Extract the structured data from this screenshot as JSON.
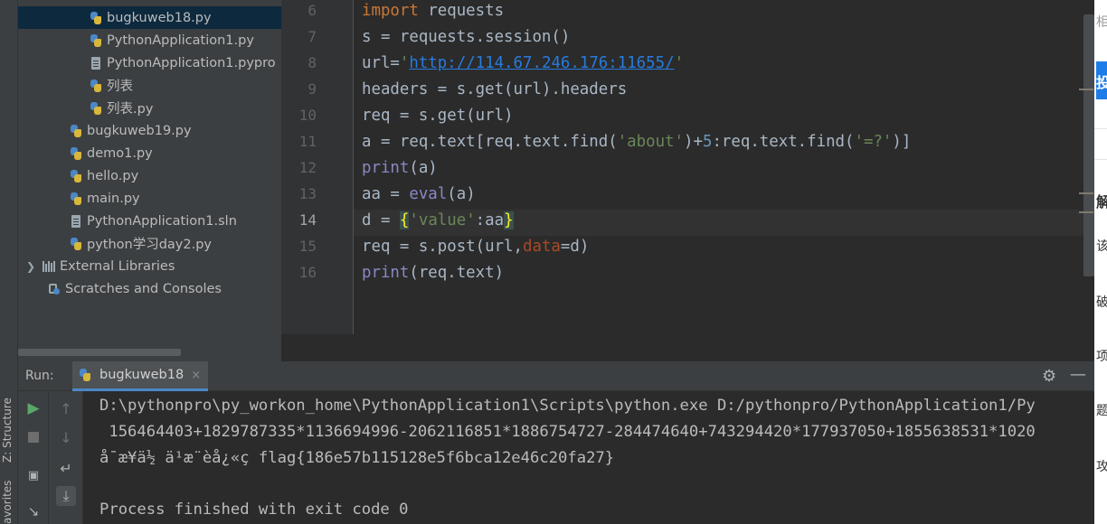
{
  "side_strip": {
    "structure_label": "Z: Structure",
    "favorites_label": "avorites"
  },
  "project_tree": [
    {
      "name": "bugkuweb18.py",
      "type": "python",
      "selected": true
    },
    {
      "name": "PythonApplication1.py",
      "type": "python",
      "selected": false
    },
    {
      "name": "PythonApplication1.pypro",
      "type": "file",
      "selected": false
    },
    {
      "name": "列表",
      "type": "python",
      "selected": false
    },
    {
      "name": "列表.py",
      "type": "python",
      "selected": false
    },
    {
      "name": "bugkuweb19.py",
      "type": "python",
      "selected": false
    },
    {
      "name": "demo1.py",
      "type": "python",
      "selected": false
    },
    {
      "name": "hello.py",
      "type": "python",
      "selected": false
    },
    {
      "name": "main.py",
      "type": "python",
      "selected": false
    },
    {
      "name": "PythonApplication1.sln",
      "type": "file",
      "selected": false
    },
    {
      "name": "python学习day2.py",
      "type": "python",
      "selected": false
    },
    {
      "name": "External Libraries",
      "type": "library",
      "selected": false
    },
    {
      "name": "Scratches and Consoles",
      "type": "scratch",
      "selected": false
    }
  ],
  "editor": {
    "line_numbers": [
      "6",
      "7",
      "8",
      "9",
      "10",
      "11",
      "12",
      "13",
      "14",
      "15",
      "16"
    ],
    "current_line": "14",
    "code": {
      "l6": {
        "kw": "import",
        "rest": " requests"
      },
      "l7": {
        "text": "s = requests.session()"
      },
      "l8": {
        "a": "url",
        "b": "=",
        "c": "'",
        "url": "http://114.67.246.176:11655/",
        "d": "'"
      },
      "l9": {
        "text": "headers = s.get(url).headers"
      },
      "l10": {
        "text": "req = s.get(url)"
      },
      "l11": {
        "a": "a = req.text[req.text.find(",
        "s1": "'about'",
        "b": ")+",
        "n": "5",
        "c": ":req.text.find(",
        "s2": "'=?'",
        "d": ")]"
      },
      "l12": {
        "fn": "print",
        "rest": "(a)"
      },
      "l13": {
        "a": "aa = ",
        "fn": "eval",
        "rest": "(a)"
      },
      "l14": {
        "a": "d = ",
        "open": "{",
        "s": "'value'",
        "b": ":aa",
        "close": "}"
      },
      "l15": {
        "a": "req = s.post(url,",
        "p": "data",
        "b": "=d)"
      },
      "l16": {
        "fn": "print",
        "rest": "(req.text)"
      }
    }
  },
  "run": {
    "label": "Run:",
    "tab": "bugkuweb18",
    "tab_close": "×",
    "gear_icon": "⚙",
    "minimize_icon": "—",
    "console": [
      "D:\\pythonpro\\py_workon_home\\PythonApplication1\\Scripts\\python.exe D:/pythonpro/PythonApplication1/Py",
      " 156464403+1829787335*1136694996-2062116851*1886754727-284474640+743294420*177937050+1855638531*1020",
      "å¯æ¥ä½ ä¹æ¨èå¿«ç flag{186e57b115128e5f6bca12e46c20fa27}",
      "",
      "Process finished with exit code 0"
    ]
  },
  "browser_sliver": {
    "text1": "相",
    "button": "投",
    "text2": "解",
    "text3": "该",
    "text4": "破",
    "text5": "项",
    "text6": "题",
    "text7": "攻"
  }
}
